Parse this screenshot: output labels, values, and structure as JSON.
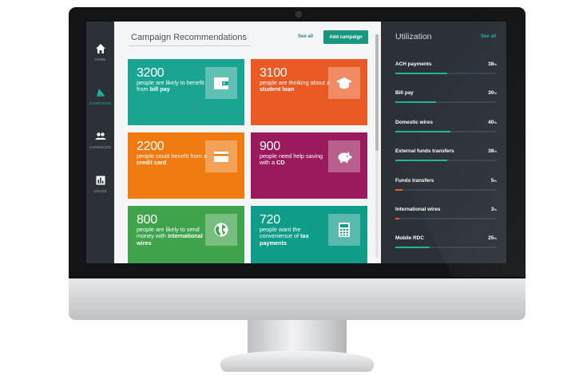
{
  "colors": {
    "accent": "#17977f",
    "sidebar": "#2b3137",
    "teal": "#1fb59b",
    "low": "#ea5a24"
  },
  "sidebar": {
    "items": [
      {
        "label": "HOME",
        "icon": "home-icon",
        "active": false
      },
      {
        "label": "CAMPAIGNS",
        "icon": "megaphone-icon",
        "active": true
      },
      {
        "label": "AUDIENCES",
        "icon": "people-icon",
        "active": false
      },
      {
        "label": "USAGE",
        "icon": "bar-chart-icon",
        "active": false
      }
    ]
  },
  "main": {
    "title": "Campaign Recommendations",
    "see_all": "See all",
    "add_button": "Add campaign",
    "tiles": [
      {
        "number": "3200",
        "text_pre": "people are likely to benefit from ",
        "text_bold": "bill pay",
        "text_post": "",
        "color": "#1aa592",
        "icon": "wallet-icon"
      },
      {
        "number": "3100",
        "text_pre": "people are thinking about a ",
        "text_bold": "student loan",
        "text_post": "",
        "color": "#ea5a24",
        "icon": "graduation-cap-icon"
      },
      {
        "number": "2200",
        "text_pre": "people could benefit from a ",
        "text_bold": "credit card",
        "text_post": "",
        "color": "#f07a10",
        "icon": "credit-card-icon"
      },
      {
        "number": "900",
        "text_pre": "people need help saving with a ",
        "text_bold": "CD",
        "text_post": "",
        "color": "#9b1a5e",
        "icon": "piggy-bank-icon"
      },
      {
        "number": "800",
        "text_pre": "people are likely to send money with ",
        "text_bold": "international wires",
        "text_post": "",
        "color": "#3ea34a",
        "icon": "globe-icon"
      },
      {
        "number": "720",
        "text_pre": "people want the convenience of ",
        "text_bold": "tax payments",
        "text_post": "",
        "color": "#0f9d8a",
        "icon": "calculator-icon"
      }
    ]
  },
  "utilization": {
    "title": "Utilization",
    "see_all": "See all",
    "items": [
      {
        "name": "ACH payments",
        "value": "38",
        "unit": "%",
        "fraction": 0.38,
        "color": "#1fb59b"
      },
      {
        "name": "Bill pay",
        "value": "30",
        "unit": "%",
        "fraction": 0.3,
        "color": "#1fb59b"
      },
      {
        "name": "Domestic wires",
        "value": "40",
        "unit": "%",
        "fraction": 0.4,
        "color": "#1fb59b"
      },
      {
        "name": "External funds transfers",
        "value": "38",
        "unit": "%",
        "fraction": 0.38,
        "color": "#1fb59b"
      },
      {
        "name": "Funds transfers",
        "value": "5",
        "unit": "%",
        "fraction": 0.05,
        "color": "#ea5a24"
      },
      {
        "name": "International wires",
        "value": "3",
        "unit": "%",
        "fraction": 0.03,
        "color": "#ea5a24"
      },
      {
        "name": "Mobile RDC",
        "value": "25",
        "unit": "%",
        "fraction": 0.25,
        "color": "#1fb59b"
      }
    ]
  }
}
